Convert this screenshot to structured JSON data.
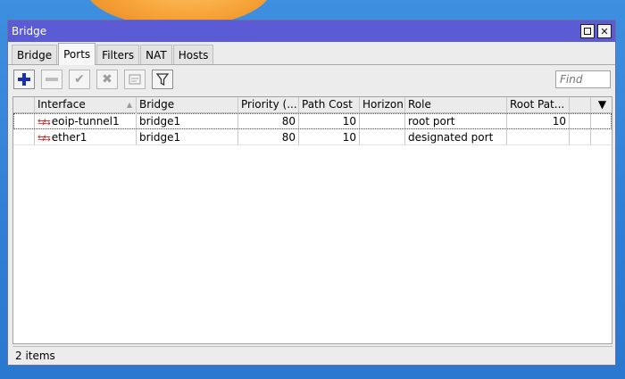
{
  "window": {
    "title": "Bridge"
  },
  "tabs": [
    {
      "label": "Bridge"
    },
    {
      "label": "Ports"
    },
    {
      "label": "Filters"
    },
    {
      "label": "NAT"
    },
    {
      "label": "Hosts"
    }
  ],
  "active_tab": "Ports",
  "toolbar": {
    "find_placeholder": "Find"
  },
  "table": {
    "columns": [
      "Interface",
      "Bridge",
      "Priority (...",
      "Path Cost",
      "Horizon",
      "Role",
      "Root Pat..."
    ],
    "rows": [
      {
        "interface": "eoip-tunnel1",
        "bridge": "bridge1",
        "priority": "80",
        "path_cost": "10",
        "horizon": "",
        "role": "root port",
        "root_path_cost": "10"
      },
      {
        "interface": "ether1",
        "bridge": "bridge1",
        "priority": "80",
        "path_cost": "10",
        "horizon": "",
        "role": "designated port",
        "root_path_cost": ""
      }
    ]
  },
  "status": {
    "count": "2 items"
  },
  "colors": {
    "titlebar": "#5b5bd6",
    "add_icon": "#1a2fae",
    "interface_icon": "#c0262c"
  }
}
